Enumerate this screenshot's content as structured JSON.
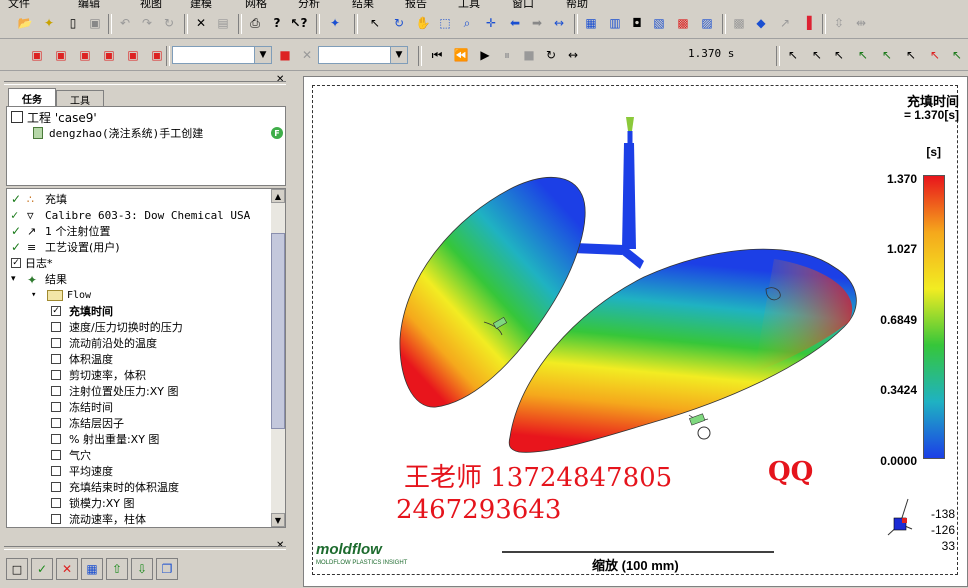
{
  "menu": [
    "文件",
    "编辑",
    "视图",
    "建模",
    "网格",
    "分析",
    "结果",
    "报告",
    "工具",
    "窗口",
    "帮助"
  ],
  "toolbar": {
    "time_value": "1.370 s",
    "time_fraction": 0.97
  },
  "panel": {
    "tabs": [
      "任务",
      "工具"
    ],
    "project_label": "工程 'case9'",
    "study_label": "dengzhao(浇注系统)手工创建",
    "tasks": [
      {
        "label": "充填",
        "checked": true
      },
      {
        "label": "Calibre 603-3: Dow Chemical USA",
        "checked": true
      },
      {
        "label": "1 个注射位置",
        "checked": true
      },
      {
        "label": "工艺设置(用户)",
        "checked": true
      }
    ],
    "log_label": "日志*",
    "results_label": "结果",
    "flow_label": "Flow",
    "results": [
      {
        "label": "充填时间",
        "checked": true
      },
      {
        "label": "速度/压力切换时的压力",
        "checked": false
      },
      {
        "label": "流动前沿处的温度",
        "checked": false
      },
      {
        "label": "体积温度",
        "checked": false
      },
      {
        "label": "剪切速率，体积",
        "checked": false
      },
      {
        "label": "注射位置处压力:XY 图",
        "checked": false
      },
      {
        "label": "冻结时间",
        "checked": false
      },
      {
        "label": "冻结层因子",
        "checked": false
      },
      {
        "label": "% 射出重量:XY 图",
        "checked": false
      },
      {
        "label": "气穴",
        "checked": false
      },
      {
        "label": "平均速度",
        "checked": false
      },
      {
        "label": "充填结束时的体积温度",
        "checked": false
      },
      {
        "label": "锁模力:XY 图",
        "checked": false
      },
      {
        "label": "流动速率，柱体",
        "checked": false
      }
    ]
  },
  "viewport": {
    "result_title": "充填时间",
    "result_value": "= 1.370[s]",
    "unit": "[s]",
    "legend_ticks": [
      "1.370",
      "1.027",
      "0.6849",
      "0.3424",
      "0.0000"
    ],
    "legend_colors": [
      "#e8151c",
      "#f5a81c",
      "#f2ec22",
      "#36c63a",
      "#1fb2c2",
      "#1c3fe6"
    ],
    "watermark_line1": "王老师 13724847805",
    "watermark_qq": "QQ",
    "watermark_line2": "2467293643",
    "scale_label": "缩放 (100 mm)",
    "logo": "moldflow",
    "logo_sub": "MOLDFLOW PLASTICS INSIGHT",
    "axis_values": [
      "-138",
      "-126",
      "33"
    ]
  }
}
